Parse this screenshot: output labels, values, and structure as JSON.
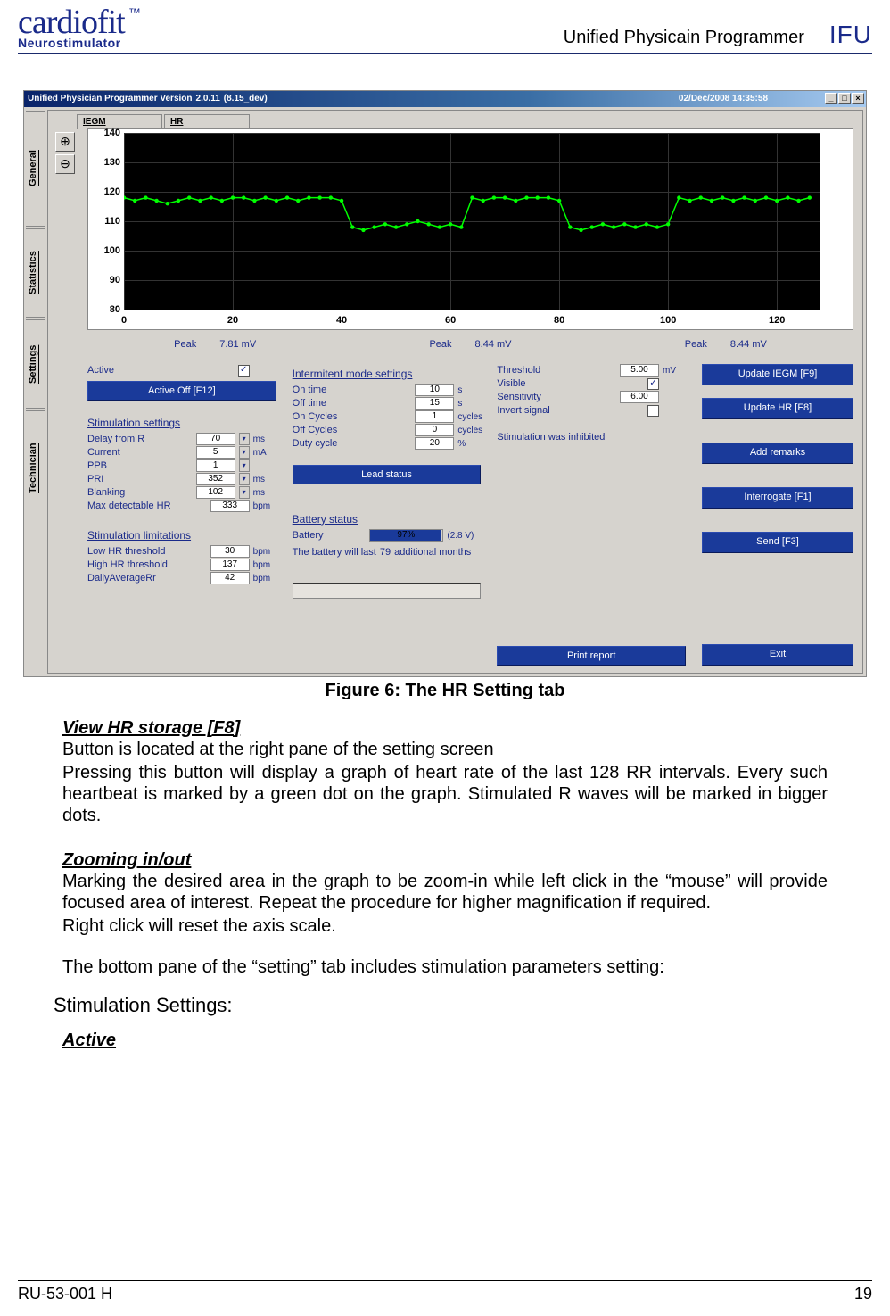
{
  "header": {
    "brand": "cardiofit",
    "tm": "™",
    "brand_sub": "Neurostimulator",
    "title": "Unified Physicain Programmer",
    "badge": "IFU"
  },
  "screenshot": {
    "titlebar": {
      "app": "Unified Physician Programmer Version",
      "ver": "2.0.11",
      "build": "(8.15_dev)",
      "date": "02/Dec/2008 14:35:58",
      "btn_min": "_",
      "btn_max": "□",
      "btn_close": "×"
    },
    "sidetabs": [
      "General",
      "Statistics",
      "Settings",
      "Technician"
    ],
    "subtabs": [
      "IEGM",
      "HR"
    ],
    "zoom_in": "⊕",
    "zoom_out": "⊖",
    "peaks": [
      {
        "label": "Peak",
        "value": "7.81 mV"
      },
      {
        "label": "Peak",
        "value": "8.44 mV"
      },
      {
        "label": "Peak",
        "value": "8.44 mV"
      }
    ],
    "col1": {
      "active_label": "Active",
      "active_checked": "✓",
      "active_off_btn": "Active Off [F12]",
      "stim_hdr": "Stimulation settings",
      "stim": [
        {
          "label": "Delay from R",
          "value": "70",
          "unit": "ms",
          "dd": true
        },
        {
          "label": "Current",
          "value": "5",
          "unit": "mA",
          "dd": true
        },
        {
          "label": "PPB",
          "value": "1",
          "unit": "",
          "dd": true
        },
        {
          "label": "PRI",
          "value": "352",
          "unit": "ms",
          "dd": true
        },
        {
          "label": "Blanking",
          "value": "102",
          "unit": "ms",
          "dd": true
        },
        {
          "label": "Max detectable HR",
          "value": "333",
          "unit": "bpm",
          "dd": false
        }
      ],
      "lim_hdr": "Stimulation limitations",
      "lim": [
        {
          "label": "Low HR threshold",
          "value": "30",
          "unit": "bpm"
        },
        {
          "label": "High HR threshold",
          "value": "137",
          "unit": "bpm"
        },
        {
          "label": "DailyAverageRr",
          "value": "42",
          "unit": "bpm"
        }
      ]
    },
    "col2": {
      "int_hdr": "Intermitent mode settings",
      "int": [
        {
          "label": "On time",
          "value": "10",
          "unit": "s"
        },
        {
          "label": "Off time",
          "value": "15",
          "unit": "s"
        },
        {
          "label": "On Cycles",
          "value": "1",
          "unit": "cycles"
        },
        {
          "label": "Off Cycles",
          "value": "0",
          "unit": "cycles"
        },
        {
          "label": "Duty cycle",
          "value": "20",
          "unit": "%"
        }
      ],
      "lead_btn": "Lead status",
      "bat_hdr": "Battery status",
      "bat_label": "Battery",
      "bat_pct": "97%",
      "bat_pct_num": 97,
      "bat_volt": "(2.8 V)",
      "bat_life_pre": "The battery will last",
      "bat_life_val": "79",
      "bat_life_post": "additional months"
    },
    "col3": {
      "rows": [
        {
          "label": "Threshold",
          "value": "5.00",
          "unit": "mV"
        },
        {
          "label": "Visible",
          "check": "✓"
        },
        {
          "label": "Sensitivity",
          "value": "6.00",
          "unit": ""
        },
        {
          "label": "Invert signal",
          "check": ""
        }
      ],
      "note": "Stimulation was inhibited",
      "print_btn": "Print report"
    },
    "col4": {
      "buttons": [
        "Update IEGM [F9]",
        "Update HR [F8]",
        "Add remarks",
        "Interrogate  [F1]",
        "Send [F3]",
        "Exit"
      ]
    }
  },
  "chart_data": {
    "type": "line",
    "title": "HR",
    "xlabel": "",
    "ylabel": "",
    "xlim": [
      0,
      128
    ],
    "ylim": [
      80,
      140
    ],
    "xticks": [
      0,
      20,
      40,
      60,
      80,
      100,
      120
    ],
    "yticks": [
      80,
      90,
      100,
      110,
      120,
      130,
      140
    ],
    "series": [
      {
        "name": "HR",
        "color": "#00ff00",
        "x": [
          0,
          2,
          4,
          6,
          8,
          10,
          12,
          14,
          16,
          18,
          20,
          22,
          24,
          26,
          28,
          30,
          32,
          34,
          36,
          38,
          40,
          42,
          44,
          46,
          48,
          50,
          52,
          54,
          56,
          58,
          60,
          62,
          64,
          66,
          68,
          70,
          72,
          74,
          76,
          78,
          80,
          82,
          84,
          86,
          88,
          90,
          92,
          94,
          96,
          98,
          100,
          102,
          104,
          106,
          108,
          110,
          112,
          114,
          116,
          118,
          120,
          122,
          124,
          126
        ],
        "y": [
          118,
          117,
          118,
          117,
          116,
          117,
          118,
          117,
          118,
          117,
          118,
          118,
          117,
          118,
          117,
          118,
          117,
          118,
          118,
          118,
          117,
          108,
          107,
          108,
          109,
          108,
          109,
          110,
          109,
          108,
          109,
          108,
          118,
          117,
          118,
          118,
          117,
          118,
          118,
          118,
          117,
          108,
          107,
          108,
          109,
          108,
          109,
          108,
          109,
          108,
          109,
          118,
          117,
          118,
          117,
          118,
          117,
          118,
          117,
          118,
          117,
          118,
          117,
          118
        ]
      }
    ]
  },
  "figcaption": "Figure 6: The HR Setting tab",
  "doc": {
    "h1": "View HR storage [F8]",
    "p1": "Button is located at the right pane of the setting screen",
    "p2": "Pressing this button will display a graph of heart rate of the last 128 RR intervals. Every such heartbeat is marked by a green dot on the graph. Stimulated R waves will be marked in bigger dots.",
    "h2": "Zooming in/out",
    "p3": "Marking the desired area in the graph to be zoom-in while left click in the “mouse” will provide focused area of interest. Repeat the procedure for higher magnification if required.",
    "p4": "Right click will reset the axis scale.",
    "p5": "The bottom pane of the “setting” tab includes stimulation parameters setting:",
    "h3": "Stimulation Settings:",
    "h4": "Active"
  },
  "footer": {
    "left": "RU-53-001 H",
    "right": "19"
  }
}
